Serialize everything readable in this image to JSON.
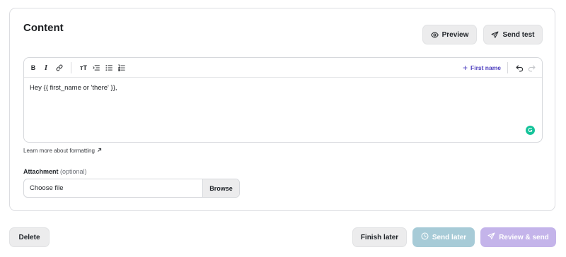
{
  "content": {
    "title": "Content",
    "preview_label": "Preview",
    "send_test_label": "Send test"
  },
  "editor": {
    "toolbar": {
      "bold": "B",
      "italic": "I",
      "text_size": "тT",
      "first_name_label": "First name"
    },
    "body_text": "Hey {{ first_name or 'there' }},",
    "grammarly_badge": "G"
  },
  "learn_more_label": "Learn more about formatting",
  "attachment": {
    "label": "Attachment",
    "optional": "(optional)",
    "file_text": "Choose file",
    "browse_label": "Browse"
  },
  "footer": {
    "delete_label": "Delete",
    "finish_later_label": "Finish later",
    "send_later_label": "Send later",
    "review_send_label": "Review & send"
  },
  "colors": {
    "accent": "#4a3bbd",
    "send_later_bg": "#a7cbd7",
    "review_send_bg": "#c4b4ea",
    "grammarly": "#15c39a"
  },
  "icons": [
    "eye-icon",
    "send-icon",
    "link-icon",
    "text-size-icon",
    "indent-icon",
    "bulleted-list-icon",
    "numbered-list-icon",
    "plus-icon",
    "undo-icon",
    "redo-icon",
    "external-arrow-icon",
    "clock-icon"
  ]
}
